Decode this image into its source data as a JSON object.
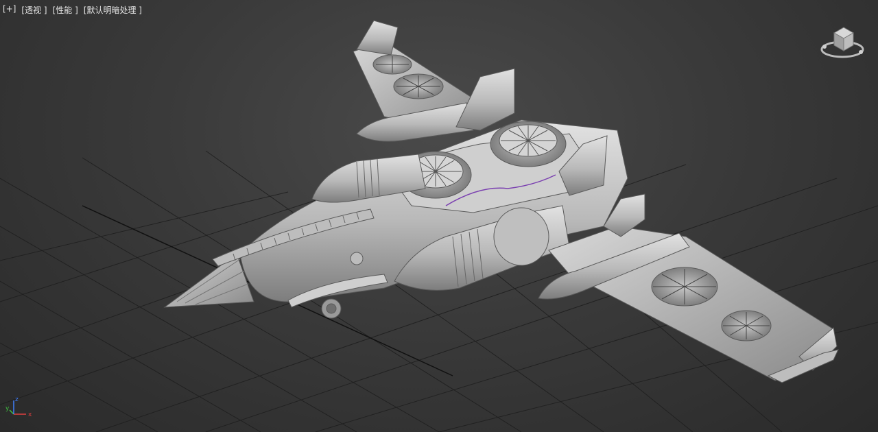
{
  "viewport": {
    "labels": {
      "plus": "[+]",
      "view": "[透视 ]",
      "shading": "[性能 ]",
      "lighting": "[默认明暗处理 ]"
    },
    "view_mode": "perspective",
    "grid": true
  },
  "axes": {
    "x_label": "x",
    "y_label": "y",
    "z_label": "z",
    "colors": {
      "x": "#e04040",
      "y": "#40c040",
      "z": "#4080ff"
    }
  },
  "scene": {
    "object": "spaceship-model",
    "model_color": "#c8c8c8",
    "highlight_color": "#7a3fb0",
    "grid_color": "#1e1e1e"
  },
  "icons": {
    "viewcube": "viewcube-icon",
    "axis": "axis-tripod-icon"
  }
}
